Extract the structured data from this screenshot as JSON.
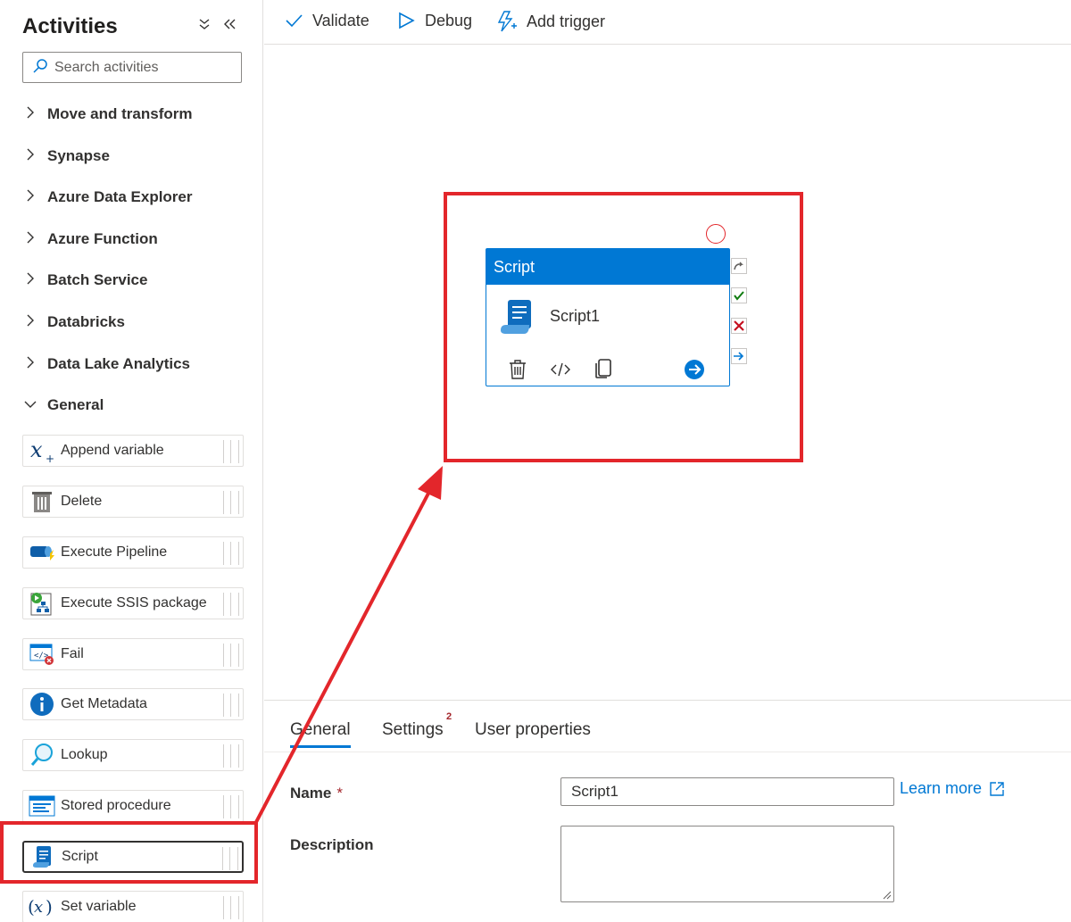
{
  "sidebar": {
    "title": "Activities",
    "search_placeholder": "Search activities",
    "categories": [
      {
        "label": "Move and transform"
      },
      {
        "label": "Synapse"
      },
      {
        "label": "Azure Data Explorer"
      },
      {
        "label": "Azure Function"
      },
      {
        "label": "Batch Service"
      },
      {
        "label": "Databricks"
      },
      {
        "label": "Data Lake Analytics"
      },
      {
        "label": "General"
      }
    ],
    "activities": [
      {
        "label": "Append variable",
        "icon": "append-variable-icon"
      },
      {
        "label": "Delete",
        "icon": "trash-bin-icon"
      },
      {
        "label": "Execute Pipeline",
        "icon": "execute-pipeline-icon"
      },
      {
        "label": "Execute SSIS package",
        "icon": "ssis-package-icon"
      },
      {
        "label": "Fail",
        "icon": "fail-icon"
      },
      {
        "label": "Get Metadata",
        "icon": "info-icon"
      },
      {
        "label": "Lookup",
        "icon": "lookup-icon"
      },
      {
        "label": "Stored procedure",
        "icon": "stored-procedure-icon"
      },
      {
        "label": "Script",
        "icon": "script-icon"
      },
      {
        "label": "Set variable",
        "icon": "set-variable-icon"
      }
    ]
  },
  "toolbar": {
    "validate": "Validate",
    "debug": "Debug",
    "add_trigger": "Add trigger"
  },
  "canvas": {
    "node_type": "Script",
    "node_name": "Script1"
  },
  "properties": {
    "tabs": [
      {
        "label": "General"
      },
      {
        "label": "Settings",
        "badge": "2"
      },
      {
        "label": "User properties"
      }
    ],
    "name_label": "Name",
    "required_mark": "*",
    "name_value": "Script1",
    "learn_more": "Learn more",
    "description_label": "Description",
    "description_value": ""
  },
  "colors": {
    "accent": "#0078d4",
    "annotation": "#e3262b"
  }
}
